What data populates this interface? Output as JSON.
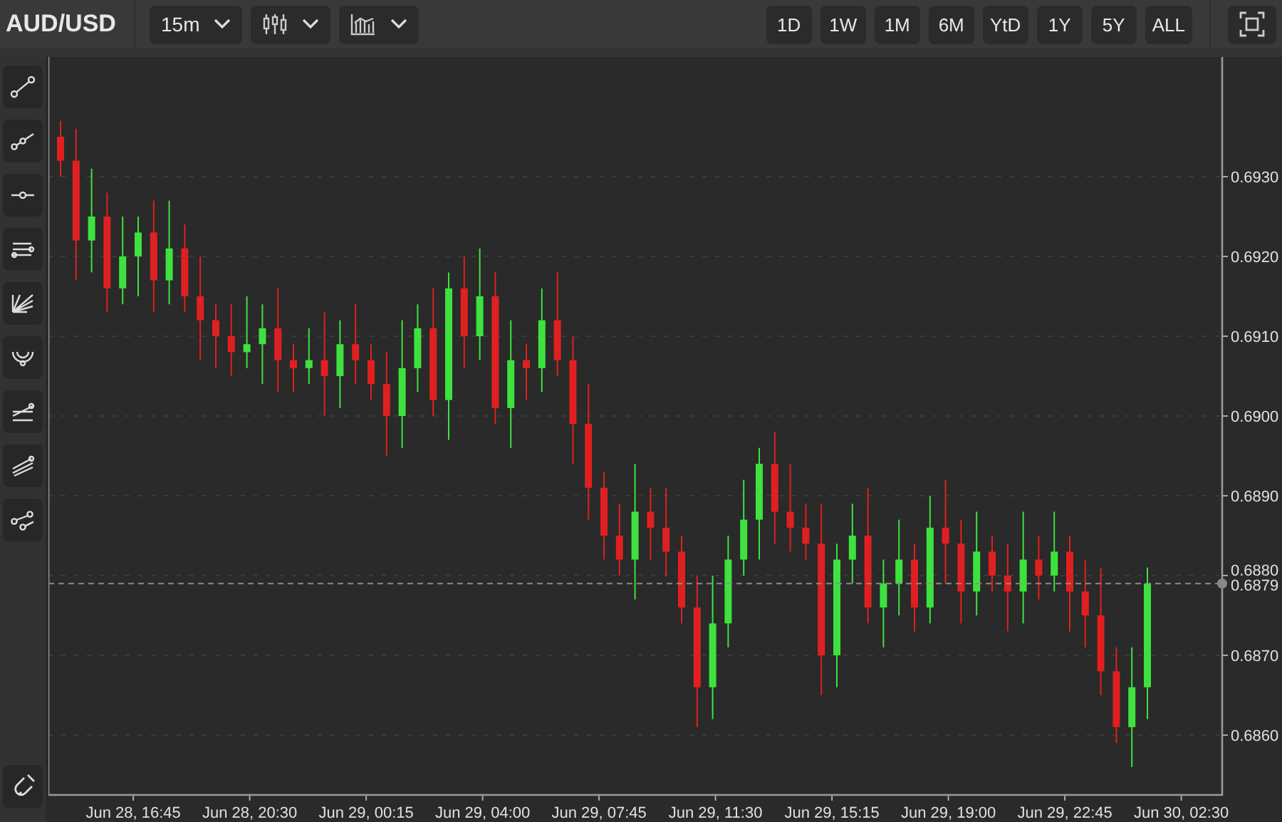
{
  "symbol": "AUD/USD",
  "interval": {
    "label": "15m"
  },
  "ranges": [
    {
      "label": "1D",
      "selected": false
    },
    {
      "label": "1W",
      "selected": false
    },
    {
      "label": "1M",
      "selected": false
    },
    {
      "label": "6M",
      "selected": false
    },
    {
      "label": "YtD",
      "selected": false
    },
    {
      "label": "1Y",
      "selected": false
    },
    {
      "label": "5Y",
      "selected": false
    },
    {
      "label": "ALL",
      "selected": false
    }
  ],
  "chart": {
    "last_price": "0.6879",
    "time_labels": [
      "Jun 28, 16:45",
      "Jun 28, 20:30",
      "Jun 29, 00:15",
      "Jun 29, 04:00",
      "Jun 29, 07:45",
      "Jun 29, 11:30",
      "Jun 29, 15:15",
      "Jun 29, 19:00",
      "Jun 29, 22:45",
      "Jun 30, 02:30"
    ],
    "chart_data": {
      "type": "candlestick",
      "grid": true,
      "ylim": [
        0.68525,
        0.6945
      ],
      "yticks": [
        {
          "value": 0.693,
          "label": "0.6930"
        },
        {
          "value": 0.692,
          "label": "0.6920"
        },
        {
          "value": 0.691,
          "label": "0.6910"
        },
        {
          "value": 0.69,
          "label": "0.6900"
        },
        {
          "value": 0.689,
          "label": "0.6890"
        },
        {
          "value": 0.688,
          "label": "0.6880"
        },
        {
          "value": 0.687,
          "label": "0.6870"
        },
        {
          "value": 0.686,
          "label": "0.6860"
        }
      ],
      "ohlc": [
        [
          0.6935,
          0.6937,
          0.693,
          0.6932
        ],
        [
          0.6932,
          0.6936,
          0.6917,
          0.6922
        ],
        [
          0.6922,
          0.6931,
          0.6918,
          0.6925
        ],
        [
          0.6925,
          0.6928,
          0.6913,
          0.6916
        ],
        [
          0.6916,
          0.6925,
          0.6914,
          0.692
        ],
        [
          0.692,
          0.6925,
          0.6915,
          0.6923
        ],
        [
          0.6923,
          0.6927,
          0.6913,
          0.6917
        ],
        [
          0.6917,
          0.6927,
          0.6914,
          0.6921
        ],
        [
          0.6921,
          0.6924,
          0.6913,
          0.6915
        ],
        [
          0.6915,
          0.692,
          0.6907,
          0.6912
        ],
        [
          0.6912,
          0.6914,
          0.6906,
          0.691
        ],
        [
          0.691,
          0.6914,
          0.6905,
          0.6908
        ],
        [
          0.6908,
          0.6915,
          0.6906,
          0.6909
        ],
        [
          0.6909,
          0.6914,
          0.6904,
          0.6911
        ],
        [
          0.6911,
          0.6916,
          0.6903,
          0.6907
        ],
        [
          0.6907,
          0.6909,
          0.6903,
          0.6906
        ],
        [
          0.6906,
          0.6911,
          0.6904,
          0.6907
        ],
        [
          0.6907,
          0.6913,
          0.69,
          0.6905
        ],
        [
          0.6905,
          0.6912,
          0.6901,
          0.6909
        ],
        [
          0.6909,
          0.6914,
          0.6904,
          0.6907
        ],
        [
          0.6907,
          0.6909,
          0.6902,
          0.6904
        ],
        [
          0.6904,
          0.6908,
          0.6895,
          0.69
        ],
        [
          0.69,
          0.6912,
          0.6896,
          0.6906
        ],
        [
          0.6906,
          0.6914,
          0.6903,
          0.6911
        ],
        [
          0.6911,
          0.6916,
          0.69,
          0.6902
        ],
        [
          0.6902,
          0.6918,
          0.6897,
          0.6916
        ],
        [
          0.6916,
          0.692,
          0.6906,
          0.691
        ],
        [
          0.691,
          0.6921,
          0.6907,
          0.6915
        ],
        [
          0.6915,
          0.6918,
          0.6899,
          0.6901
        ],
        [
          0.6901,
          0.6912,
          0.6896,
          0.6907
        ],
        [
          0.6907,
          0.6909,
          0.6902,
          0.6906
        ],
        [
          0.6906,
          0.6916,
          0.6903,
          0.6912
        ],
        [
          0.6912,
          0.6918,
          0.6905,
          0.6907
        ],
        [
          0.6907,
          0.691,
          0.6894,
          0.6899
        ],
        [
          0.6899,
          0.6904,
          0.6887,
          0.6891
        ],
        [
          0.6891,
          0.6893,
          0.6882,
          0.6885
        ],
        [
          0.6885,
          0.6889,
          0.688,
          0.6882
        ],
        [
          0.6882,
          0.6894,
          0.6877,
          0.6888
        ],
        [
          0.6888,
          0.6891,
          0.6882,
          0.6886
        ],
        [
          0.6886,
          0.6891,
          0.688,
          0.6883
        ],
        [
          0.6883,
          0.6885,
          0.6874,
          0.6876
        ],
        [
          0.6876,
          0.688,
          0.6861,
          0.6866
        ],
        [
          0.6866,
          0.688,
          0.6862,
          0.6874
        ],
        [
          0.6874,
          0.6885,
          0.6871,
          0.6882
        ],
        [
          0.6882,
          0.6892,
          0.688,
          0.6887
        ],
        [
          0.6887,
          0.6896,
          0.6882,
          0.6894
        ],
        [
          0.6894,
          0.6898,
          0.6884,
          0.6888
        ],
        [
          0.6888,
          0.6894,
          0.6883,
          0.6886
        ],
        [
          0.6886,
          0.6889,
          0.6882,
          0.6884
        ],
        [
          0.6884,
          0.6889,
          0.6865,
          0.687
        ],
        [
          0.687,
          0.6884,
          0.6866,
          0.6882
        ],
        [
          0.6882,
          0.6889,
          0.6879,
          0.6885
        ],
        [
          0.6885,
          0.6891,
          0.6874,
          0.6876
        ],
        [
          0.6876,
          0.6882,
          0.6871,
          0.6879
        ],
        [
          0.6879,
          0.6887,
          0.6875,
          0.6882
        ],
        [
          0.6882,
          0.6884,
          0.6873,
          0.6876
        ],
        [
          0.6876,
          0.689,
          0.6874,
          0.6886
        ],
        [
          0.6886,
          0.6892,
          0.6879,
          0.6884
        ],
        [
          0.6884,
          0.6887,
          0.6874,
          0.6878
        ],
        [
          0.6878,
          0.6888,
          0.6875,
          0.6883
        ],
        [
          0.6883,
          0.6885,
          0.6878,
          0.688
        ],
        [
          0.688,
          0.6884,
          0.6873,
          0.6878
        ],
        [
          0.6878,
          0.6888,
          0.6874,
          0.6882
        ],
        [
          0.6882,
          0.6885,
          0.6877,
          0.688
        ],
        [
          0.688,
          0.6888,
          0.6878,
          0.6883
        ],
        [
          0.6883,
          0.6885,
          0.6873,
          0.6878
        ],
        [
          0.6878,
          0.6882,
          0.6871,
          0.6875
        ],
        [
          0.6875,
          0.6881,
          0.6865,
          0.6868
        ],
        [
          0.6868,
          0.6871,
          0.6859,
          0.6861
        ],
        [
          0.6861,
          0.6871,
          0.6856,
          0.6866
        ],
        [
          0.6866,
          0.6881,
          0.6862,
          0.6879
        ]
      ]
    }
  }
}
